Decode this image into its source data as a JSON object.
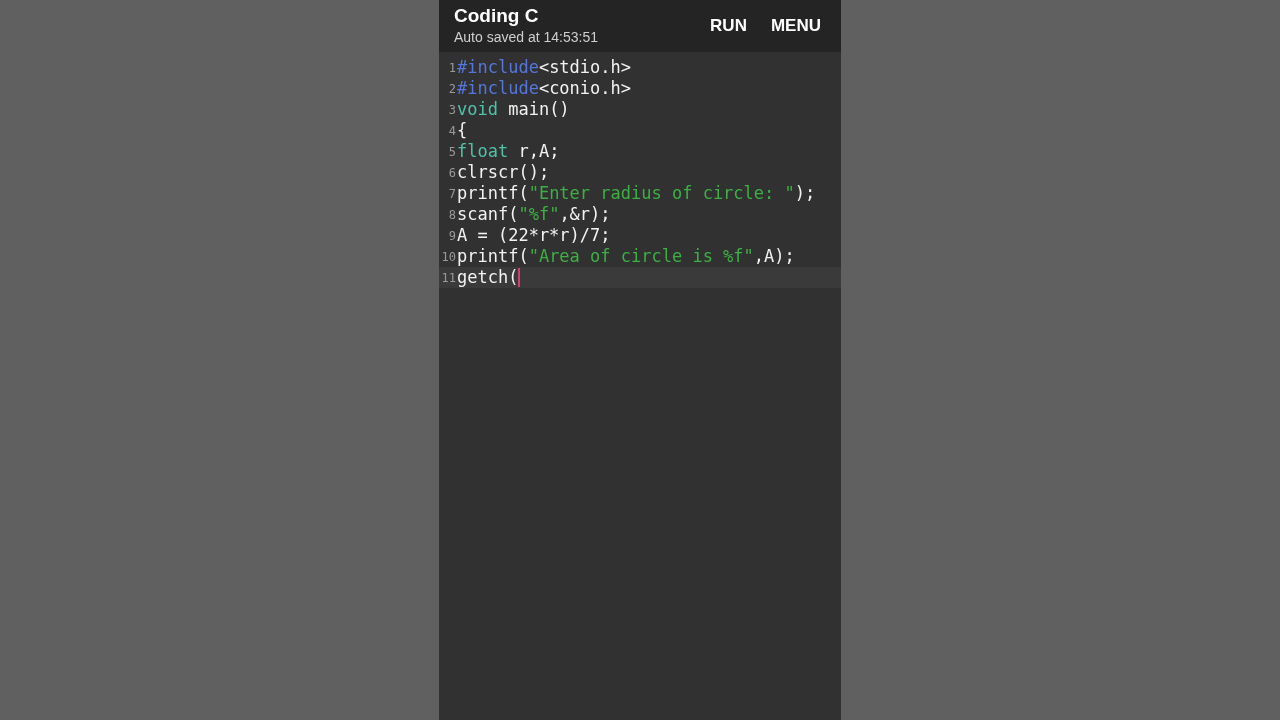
{
  "app_bar": {
    "title": "Coding C",
    "subtitle": "Auto saved at 14:53:51",
    "actions": [
      "RUN",
      "MENU"
    ]
  },
  "editor": {
    "lines": [
      {
        "number": "1",
        "selected": false,
        "tokens": [
          {
            "kind": "directive",
            "text": "#include"
          },
          {
            "kind": "plain",
            "text": "<stdio.h>"
          }
        ]
      },
      {
        "number": "2",
        "selected": false,
        "tokens": [
          {
            "kind": "directive",
            "text": "#include"
          },
          {
            "kind": "plain",
            "text": "<conio.h>"
          }
        ]
      },
      {
        "number": "3",
        "selected": false,
        "tokens": [
          {
            "kind": "type",
            "text": "void"
          },
          {
            "kind": "plain",
            "text": " main()"
          }
        ]
      },
      {
        "number": "4",
        "selected": false,
        "tokens": [
          {
            "kind": "plain",
            "text": "{"
          }
        ]
      },
      {
        "number": "5",
        "selected": false,
        "tokens": [
          {
            "kind": "type",
            "text": "float"
          },
          {
            "kind": "plain",
            "text": " r,A;"
          }
        ]
      },
      {
        "number": "6",
        "selected": false,
        "tokens": [
          {
            "kind": "plain",
            "text": "clrscr();"
          }
        ]
      },
      {
        "number": "7",
        "selected": false,
        "tokens": [
          {
            "kind": "plain",
            "text": "printf("
          },
          {
            "kind": "string",
            "text": "\"Enter radius of circle: \""
          },
          {
            "kind": "plain",
            "text": ");"
          }
        ]
      },
      {
        "number": "8",
        "selected": false,
        "tokens": [
          {
            "kind": "plain",
            "text": "scanf("
          },
          {
            "kind": "string",
            "text": "\"%f\""
          },
          {
            "kind": "plain",
            "text": ",&r);"
          }
        ]
      },
      {
        "number": "9",
        "selected": false,
        "tokens": [
          {
            "kind": "plain",
            "text": "A = (22*r*r)/7;"
          }
        ]
      },
      {
        "number": "10",
        "selected": false,
        "tokens": [
          {
            "kind": "plain",
            "text": "printf("
          },
          {
            "kind": "string",
            "text": "\"Area of circle is %f\""
          },
          {
            "kind": "plain",
            "text": ",A);"
          }
        ]
      },
      {
        "number": "11",
        "selected": true,
        "tokens": [
          {
            "kind": "plain",
            "text": "getch("
          }
        ]
      }
    ]
  }
}
